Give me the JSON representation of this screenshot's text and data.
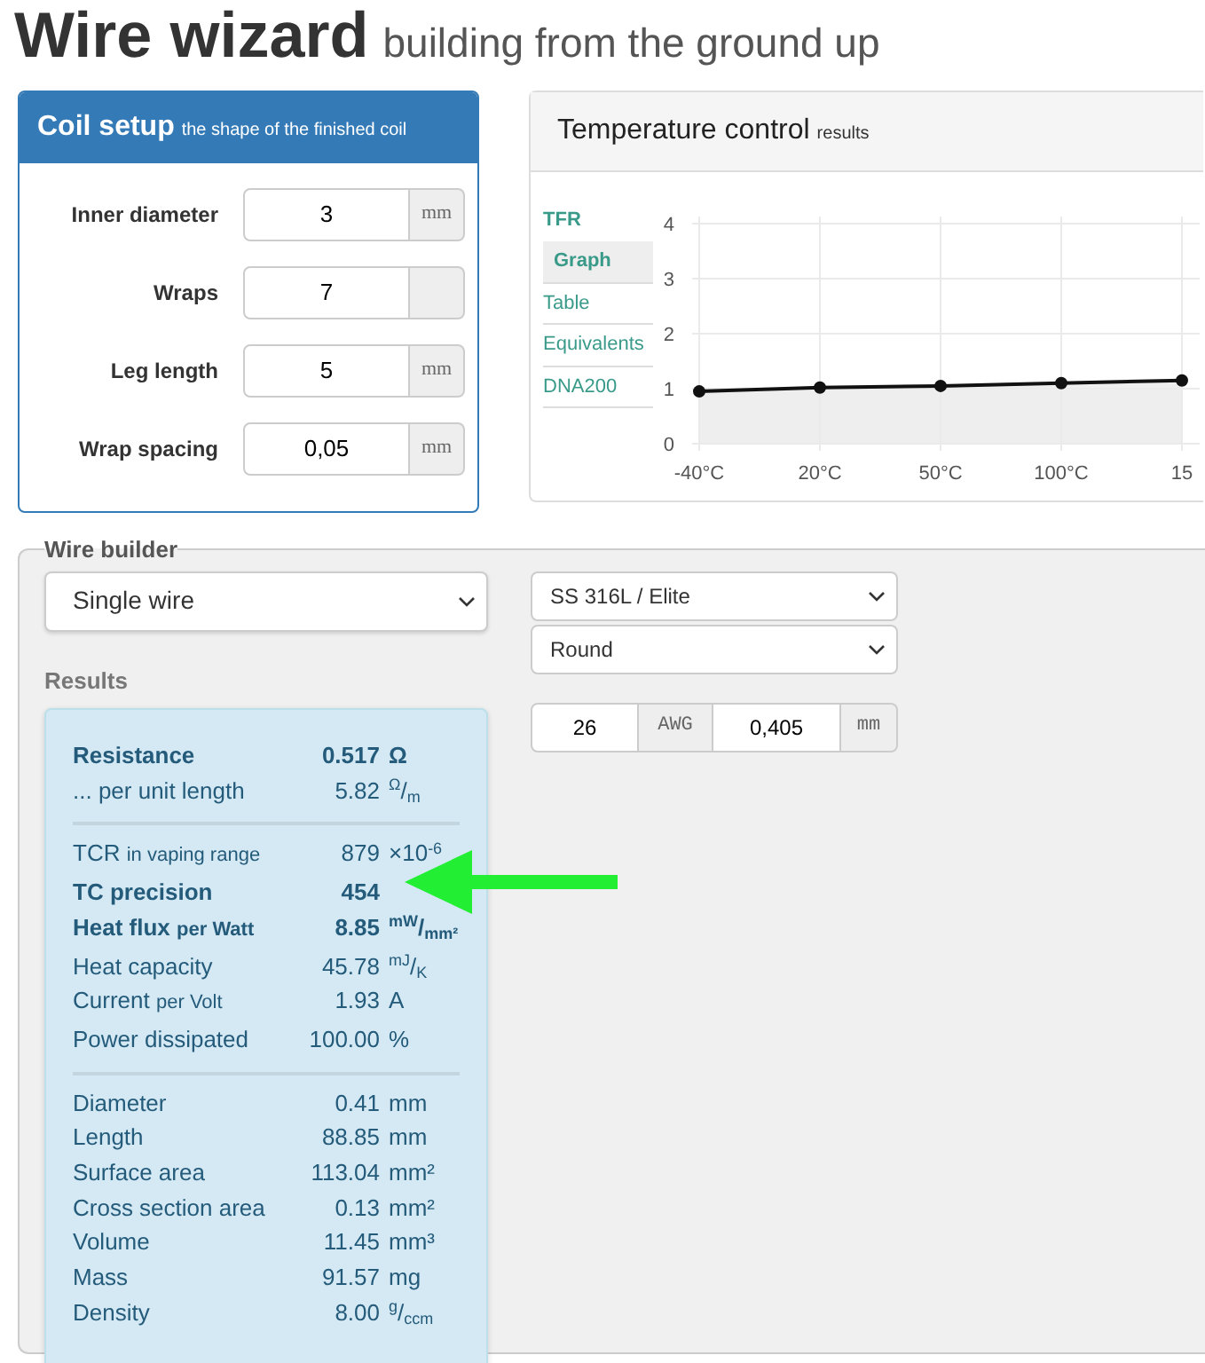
{
  "page": {
    "title": "Wire wizard",
    "subtitle": "building from the ground up"
  },
  "coil_setup": {
    "title": "Coil setup",
    "subtitle": "the shape of the finished coil",
    "fields": [
      {
        "label": "Inner diameter",
        "value": "3",
        "unit": "mm"
      },
      {
        "label": "Wraps",
        "value": "7"
      },
      {
        "label": "Leg length",
        "value": "5",
        "unit": "mm"
      },
      {
        "label": "Wrap spacing",
        "value": "0,05",
        "unit": "mm"
      }
    ]
  },
  "temperature_control": {
    "title": "Temperature control",
    "subtitle": "results",
    "nav_heading": "TFR",
    "tabs": [
      {
        "label": "Graph",
        "selected": true
      },
      {
        "label": "Table",
        "selected": false
      },
      {
        "label": "Equivalents",
        "selected": false
      },
      {
        "label": "DNA200",
        "selected": false
      }
    ],
    "chart_data": {
      "type": "line",
      "categories": [
        "-40°C",
        "20°C",
        "50°C",
        "100°C",
        "15"
      ],
      "series": [
        {
          "color": "#111111",
          "marker": true,
          "values": [
            0.95,
            1.02,
            1.05,
            1.1,
            1.15
          ]
        }
      ],
      "grid": true,
      "ylim": [
        0,
        4
      ],
      "yticks": [
        0,
        1,
        2,
        3,
        4
      ]
    }
  },
  "wire_builder": {
    "title": "Wire builder",
    "wire_type": "Single wire",
    "material": "SS 316L / Elite",
    "profile": "Round",
    "gauge": "26",
    "gauge_unit": "AWG",
    "diameter": "0,405",
    "diameter_unit": "mm",
    "results_heading": "Results",
    "results": [
      [
        {
          "label": "Resistance",
          "value": "0.517",
          "unit": "Ω",
          "bold": true
        },
        {
          "label": "... per unit length",
          "value": "5.82",
          "unit": "$^{Ω}$/$_{m}$",
          "bold": false
        }
      ],
      [
        {
          "label": "TCR",
          "note": "in vaping range",
          "value": "879",
          "unit": "×10$^{-6}$",
          "bold": false
        },
        {
          "label": "TC precision",
          "value": "454",
          "bold": true
        },
        {
          "label": "Heat flux",
          "note": "per Watt",
          "value": "8.85",
          "unit": "$^{mW}$/$_{mm²}$",
          "bold": true
        },
        {
          "label": "Heat capacity",
          "value": "45.78",
          "unit": "$^{mJ}$/$_{K}$",
          "bold": false
        },
        {
          "label": "Current",
          "note": "per Volt",
          "value": "1.93",
          "unit": "A",
          "bold": false
        },
        {
          "label": "Power dissipated",
          "value": "100.00",
          "unit": "%",
          "bold": false
        }
      ],
      [
        {
          "label": "Diameter",
          "value": "0.41",
          "unit": "mm",
          "bold": false
        },
        {
          "label": "Length",
          "value": "88.85",
          "unit": "mm",
          "bold": false
        },
        {
          "label": "Surface area",
          "value": "113.04",
          "unit": "mm²",
          "bold": false
        },
        {
          "label": "Cross section area",
          "value": "0.13",
          "unit": "mm²",
          "bold": false
        },
        {
          "label": "Volume",
          "value": "11.45",
          "unit": "mm³",
          "bold": false
        },
        {
          "label": "Mass",
          "value": "91.57",
          "unit": "mg",
          "bold": false
        },
        {
          "label": "Density",
          "value": "8.00",
          "unit": "$^{g}$/$_{ccm}$",
          "bold": false
        }
      ]
    ]
  }
}
